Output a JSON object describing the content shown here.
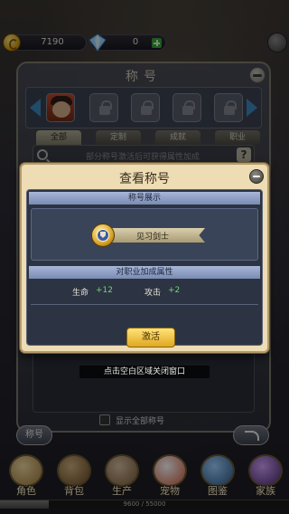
{
  "resources": {
    "gold": "7190",
    "gems": "0"
  },
  "panel": {
    "title": "称号",
    "tabs": [
      "全部",
      "定制",
      "成就",
      "职业"
    ],
    "search_hint": "部分称号激活后可获得属性加成",
    "help_symbol": "?",
    "show_all_label": "显示全部称号",
    "left_button": "称号"
  },
  "modal": {
    "title": "查看称号",
    "section_display": "称号展示",
    "title_name": "见习剑士",
    "section_attributes": "对职业加成属性",
    "stats": [
      {
        "label": "生命",
        "value": "+12"
      },
      {
        "label": "攻击",
        "value": "+2"
      }
    ],
    "activate_button": "激活"
  },
  "close_hint": "点击空白区域关闭窗口",
  "bottom_nav": [
    {
      "label": "角色",
      "icon": "character-icon",
      "color": "#c9a25a"
    },
    {
      "label": "背包",
      "icon": "backpack-icon",
      "color": "#8a6a3a"
    },
    {
      "label": "生产",
      "icon": "production-icon",
      "color": "#9a7a5a"
    },
    {
      "label": "宠物",
      "icon": "pet-icon",
      "color": "#d05a3a"
    },
    {
      "label": "图鉴",
      "icon": "codex-icon",
      "color": "#4a8ac0"
    },
    {
      "label": "家族",
      "icon": "family-icon",
      "color": "#7a4aa0"
    }
  ],
  "exp": {
    "text": "9600 / 55000",
    "fraction": 0.17
  },
  "colors": {
    "accent_gold": "#e0a820",
    "stat_green": "#6fd66f",
    "modal_bg": "#eddcb4"
  }
}
